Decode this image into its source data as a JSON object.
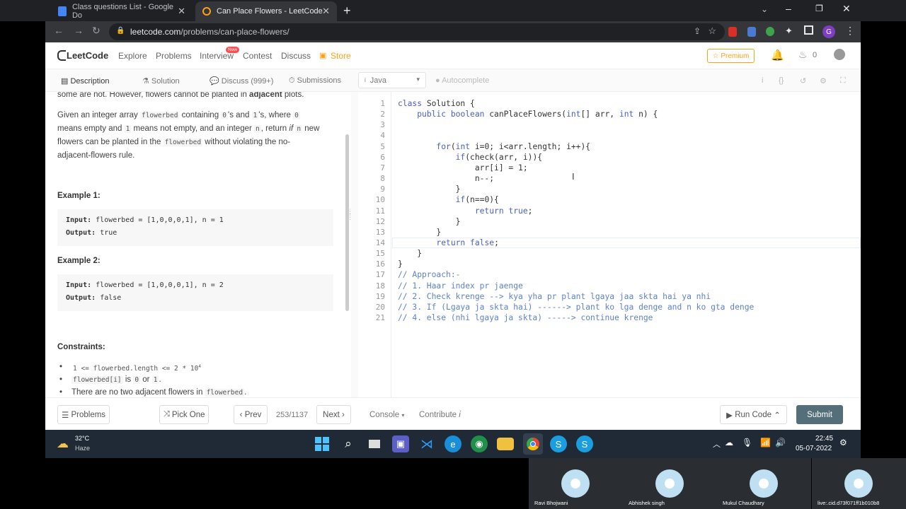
{
  "browser": {
    "tabs": [
      {
        "title": "Class questions List - Google Do"
      },
      {
        "title": "Can Place Flowers - LeetCode"
      }
    ],
    "url_domain": "leetcode.com",
    "url_path": "/problems/can-place-flowers/"
  },
  "lc_nav": {
    "logo": "LeetCode",
    "links": [
      "Explore",
      "Problems",
      "Interview",
      "Contest",
      "Discuss",
      "Store"
    ],
    "new_badge": "New",
    "premium": "Premium",
    "streak": "0"
  },
  "panel_tabs": {
    "description": "Description",
    "solution": "Solution",
    "discuss": "Discuss (999+)",
    "submissions": "Submissions",
    "language": "Java",
    "autocomplete": "Autocomplete"
  },
  "description": {
    "line0_pre": "some are not. However, flowers cannot be planted in ",
    "line0_bold": "adjacent",
    "line0_post": " plots.",
    "p1": {
      "a": "Given an integer array ",
      "c1": "flowerbed",
      "b": " containing ",
      "c2": "0",
      "c": "'s and ",
      "c3": "1",
      "d": "'s, where ",
      "c4": "0",
      "e": "means empty and ",
      "c5": "1",
      "f": " means not empty, and an integer ",
      "c6": "n",
      "g": ", return ",
      "h": "if",
      "c7": "n",
      "i": " new",
      "j": "flowers can be planted in the ",
      "c8": "flowerbed",
      "k": " without violating the no-",
      "l": "adjacent-flowers rule."
    },
    "example1_title": "Example 1:",
    "example1_input_label": "Input:",
    "example1_input": "flowerbed = [1,0,0,0,1], n = 1",
    "example1_output_label": "Output:",
    "example1_output": "true",
    "example2_title": "Example 2:",
    "example2_input_label": "Input:",
    "example2_input": "flowerbed = [1,0,0,0,1], n = 2",
    "example2_output_label": "Output:",
    "example2_output": "false",
    "constraints_title": "Constraints:",
    "c1": "1 <= flowerbed.length <= 2 * 10",
    "c1_sup": "4",
    "c2_code1": "flowerbed[i]",
    "c2_text": " is ",
    "c2_code2": "0",
    "c2_or": " or ",
    "c2_code3": "1",
    "c2_end": ".",
    "c3_text": "There are no two adjacent flowers in ",
    "c3_code": "flowerbed",
    "c3_end": "."
  },
  "code_lines": [
    "class Solution {",
    "    public boolean canPlaceFlowers(int[] arr, int n) {",
    "",
    "",
    "        for(int i=0; i<arr.length; i++){",
    "            if(check(arr, i)){",
    "                arr[i] = 1;",
    "                n--;",
    "            }",
    "            if(n==0){",
    "                return true;",
    "            }",
    "        }",
    "        return false;",
    "    }",
    "}",
    "// Approach:-",
    "// 1. Haar index pr jaenge",
    "// 2. Check krenge --> kya yha pr plant lgaya jaa skta hai ya nhi",
    "// 3. If (Lgaya ja skta hai) ------> plant ko lga denge and n ko gta denge",
    "// 4. else (nhi lgaya ja skta) -----> continue krenge"
  ],
  "line_numbers": [
    "1",
    "2",
    "3",
    "4",
    "5",
    "6",
    "7",
    "8",
    "9",
    "10",
    "11",
    "12",
    "13",
    "14",
    "15",
    "16",
    "17",
    "18",
    "19",
    "20",
    "21"
  ],
  "bottom": {
    "problems": "Problems",
    "pick_one": "Pick One",
    "prev": "Prev",
    "page": "253/1137",
    "next": "Next",
    "console": "Console",
    "contribute": "Contribute",
    "run_code": "Run Code",
    "submit": "Submit"
  },
  "taskbar": {
    "temp": "32°C",
    "weather": "Haze",
    "time": "22:45",
    "date": "05-07-2022"
  },
  "participants": [
    "Ravi Bhojwani",
    "Abhishek singh",
    "Mukul Chaudhary",
    "live:.cid.d73f071ff1b010b8"
  ],
  "colors": {
    "accent": "#ffa116",
    "submit": "#546e7a",
    "keyword": "#4a5fbf",
    "comment": "#5f82c7"
  }
}
